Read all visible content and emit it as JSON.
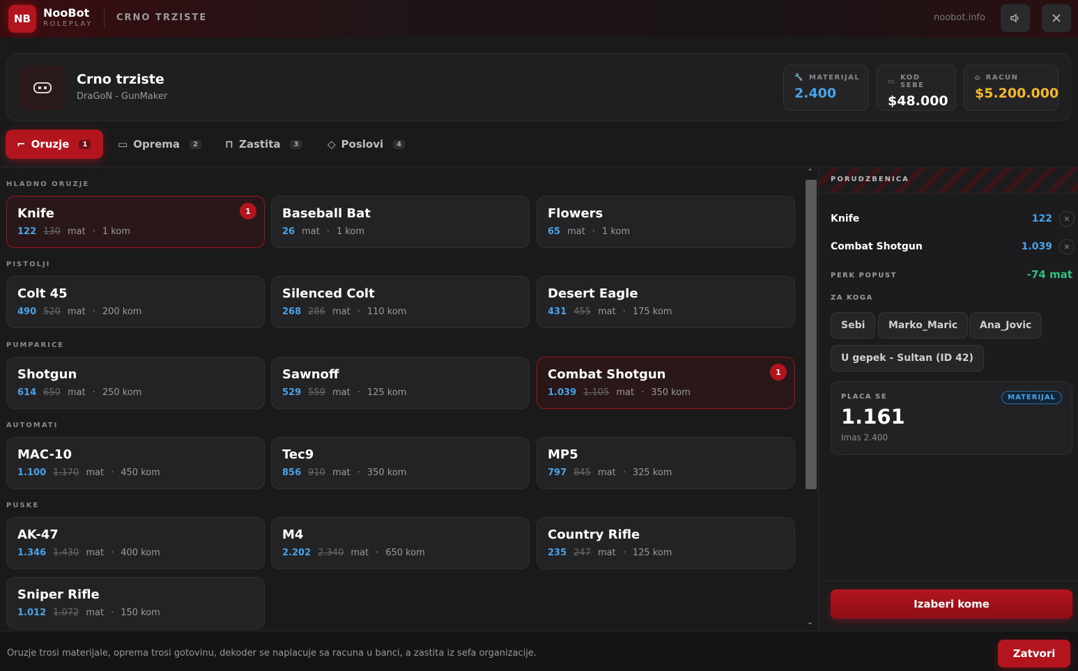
{
  "topbar": {
    "logo": "NB",
    "brand_name": "NooBot",
    "brand_sub": "ROLEPLAY",
    "title": "CRNO TRZISTE",
    "site": "noobot.info",
    "sound_icon": "speaker-icon",
    "close_icon": "close-icon"
  },
  "header": {
    "title": "Crno trziste",
    "subtitle": "DraGoN - GunMaker",
    "stats": [
      {
        "label": "MATERIJAL",
        "value": "2.400",
        "color": "#4aa3e8",
        "icon": "wrench-icon"
      },
      {
        "label": "KOD SEBE",
        "value": "$48.000",
        "color": "#ffffff",
        "icon": "cash-icon"
      },
      {
        "label": "RACUN",
        "value": "$5.200.000",
        "color": "#f5b82e",
        "icon": "bank-icon"
      }
    ]
  },
  "tabs": [
    {
      "label": "Oruzje",
      "badge": "1",
      "icon": "gun-icon"
    },
    {
      "label": "Oprema",
      "badge": "2",
      "icon": "briefcase-icon"
    },
    {
      "label": "Zastita",
      "badge": "3",
      "icon": "lock-icon"
    },
    {
      "label": "Poslovi",
      "badge": "4",
      "icon": "shield-icon"
    }
  ],
  "unit": "mat",
  "categories": [
    {
      "title": "HLADNO ORUZJE",
      "items": [
        {
          "name": "Knife",
          "price": "122",
          "old": "130",
          "stock": "1 kom",
          "badge": "1"
        },
        {
          "name": "Baseball Bat",
          "price": "26",
          "old": "",
          "stock": "1 kom",
          "badge": ""
        },
        {
          "name": "Flowers",
          "price": "65",
          "old": "",
          "stock": "1 kom",
          "badge": ""
        }
      ]
    },
    {
      "title": "PISTOLJI",
      "items": [
        {
          "name": "Colt 45",
          "price": "490",
          "old": "520",
          "stock": "200 kom",
          "badge": ""
        },
        {
          "name": "Silenced Colt",
          "price": "268",
          "old": "286",
          "stock": "110 kom",
          "badge": ""
        },
        {
          "name": "Desert Eagle",
          "price": "431",
          "old": "455",
          "stock": "175 kom",
          "badge": ""
        }
      ]
    },
    {
      "title": "PUMPARICE",
      "items": [
        {
          "name": "Shotgun",
          "price": "614",
          "old": "650",
          "stock": "250 kom",
          "badge": ""
        },
        {
          "name": "Sawnoff",
          "price": "529",
          "old": "559",
          "stock": "125 kom",
          "badge": ""
        },
        {
          "name": "Combat Shotgun",
          "price": "1.039",
          "old": "1.105",
          "stock": "350 kom",
          "badge": "1"
        }
      ]
    },
    {
      "title": "AUTOMATI",
      "items": [
        {
          "name": "MAC-10",
          "price": "1.100",
          "old": "1.170",
          "stock": "450 kom",
          "badge": ""
        },
        {
          "name": "Tec9",
          "price": "856",
          "old": "910",
          "stock": "350 kom",
          "badge": ""
        },
        {
          "name": "MP5",
          "price": "797",
          "old": "845",
          "stock": "325 kom",
          "badge": ""
        }
      ]
    },
    {
      "title": "PUSKE",
      "items": [
        {
          "name": "AK-47",
          "price": "1.346",
          "old": "1.430",
          "stock": "400 kom",
          "badge": ""
        },
        {
          "name": "M4",
          "price": "2.202",
          "old": "2.340",
          "stock": "650 kom",
          "badge": ""
        },
        {
          "name": "Country Rifle",
          "price": "235",
          "old": "247",
          "stock": "125 kom",
          "badge": ""
        },
        {
          "name": "Sniper Rifle",
          "price": "1.012",
          "old": "1.072",
          "stock": "150 kom",
          "badge": ""
        }
      ]
    }
  ],
  "order": {
    "title": "PORUDZBENICA",
    "items": [
      {
        "name": "Knife",
        "price": "122"
      },
      {
        "name": "Combat Shotgun",
        "price": "1.039"
      }
    ],
    "perk_label": "PERK POPUST",
    "perk_value": "-74 mat",
    "for_label": "ZA KOGA",
    "recipients": [
      "Sebi",
      "Marko_Maric",
      "Ana_Jovic",
      "U gepek - Sultan (ID 42)"
    ],
    "pay_label": "PLACA SE",
    "pay_tag": "MATERIJAL",
    "pay_value": "1.161",
    "pay_sub": "Imas 2.400",
    "choose_button": "Izaberi kome"
  },
  "footer": {
    "text": "Oruzje trosi materijale, oprema trosi gotovinu, dekoder se naplacuje sa racuna u banci, a zastita iz sefa organizacije.",
    "close_button": "Zatvori"
  }
}
